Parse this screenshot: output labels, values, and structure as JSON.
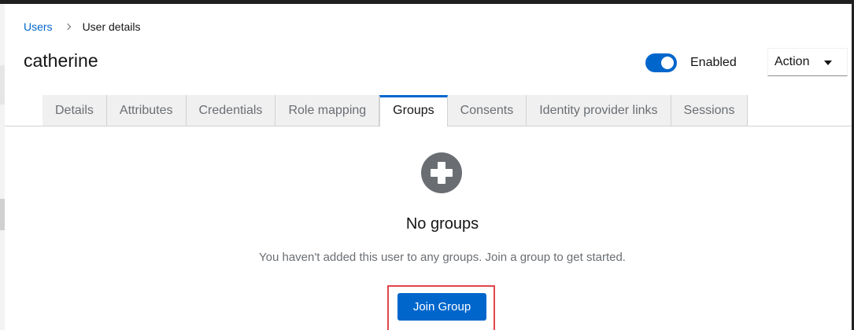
{
  "breadcrumb": {
    "parent": "Users",
    "current": "User details"
  },
  "header": {
    "title": "catherine",
    "enabled_label": "Enabled",
    "enabled": true,
    "action_label": "Action"
  },
  "tabs": [
    {
      "label": "Details"
    },
    {
      "label": "Attributes"
    },
    {
      "label": "Credentials"
    },
    {
      "label": "Role mapping"
    },
    {
      "label": "Groups",
      "active": true
    },
    {
      "label": "Consents"
    },
    {
      "label": "Identity provider links"
    },
    {
      "label": "Sessions"
    }
  ],
  "empty_state": {
    "icon": "plus-circle-icon",
    "title": "No groups",
    "body": "You haven't added this user to any groups. Join a group to get started.",
    "button_label": "Join Group"
  },
  "colors": {
    "accent": "#0066cc",
    "highlight": "#e0474c"
  }
}
